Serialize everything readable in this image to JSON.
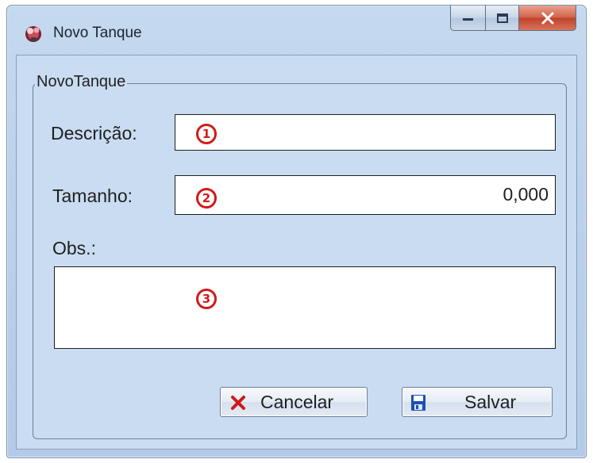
{
  "window": {
    "title": "Novo Tanque",
    "icons": {
      "app": "app-tank-icon",
      "minimize": "minimize-icon",
      "maximize": "maximize-icon",
      "close": "close-icon"
    }
  },
  "group": {
    "legend": "NovoTanque"
  },
  "form": {
    "descricao": {
      "label": "Descrição:",
      "value": "",
      "marker": "1"
    },
    "tamanho": {
      "label": "Tamanho:",
      "value": "0,000",
      "marker": "2"
    },
    "obs": {
      "label": "Obs.:",
      "value": "",
      "marker": "3"
    }
  },
  "buttons": {
    "cancel": {
      "label": "Cancelar",
      "icon": "red-x-icon"
    },
    "save": {
      "label": "Salvar",
      "icon": "floppy-disk-icon"
    }
  },
  "colors": {
    "marker_red": "#d11a1a",
    "cancel_icon_red": "#d01818",
    "save_icon_blue": "#1b4fb5",
    "window_bg": "#c9dcf1"
  }
}
